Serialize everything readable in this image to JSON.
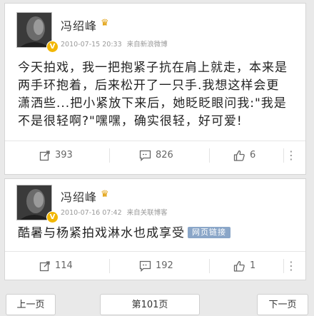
{
  "posts": [
    {
      "author": "冯绍峰",
      "verified_badge": "V",
      "crown_icon": "crown-icon",
      "timestamp": "2010-07-15 20:33",
      "source": "来自新浪微博",
      "text_lines": [
        "今天拍戏，我一把抱紧子抗在肩上就走，本来是",
        "两手环抱着，后来松开了一只手.我想这样会更",
        "潇洒些...把小紧放下来后，她眨眨眼问我:\"我是",
        "不是很轻啊?\"嘿嘿，确实很轻，好可爱!"
      ],
      "repost_count": "393",
      "comment_count": "826",
      "like_count": "6"
    },
    {
      "author": "冯绍峰",
      "verified_badge": "V",
      "crown_icon": "crown-icon",
      "timestamp": "2010-07-16 07:42",
      "source": "来自关联博客",
      "text": "酷暑与杨紧拍戏淋水也成享受",
      "tag": "网页链接",
      "repost_count": "114",
      "comment_count": "192",
      "like_count": "1"
    }
  ],
  "pagination": {
    "prev_label": "上一页",
    "page_label": "第101页",
    "next_label": "下一页"
  },
  "colors": {
    "accent_blue": "#5b86b8",
    "badge_gold": "#f2b705",
    "tag_bg": "#8aa6c8"
  }
}
